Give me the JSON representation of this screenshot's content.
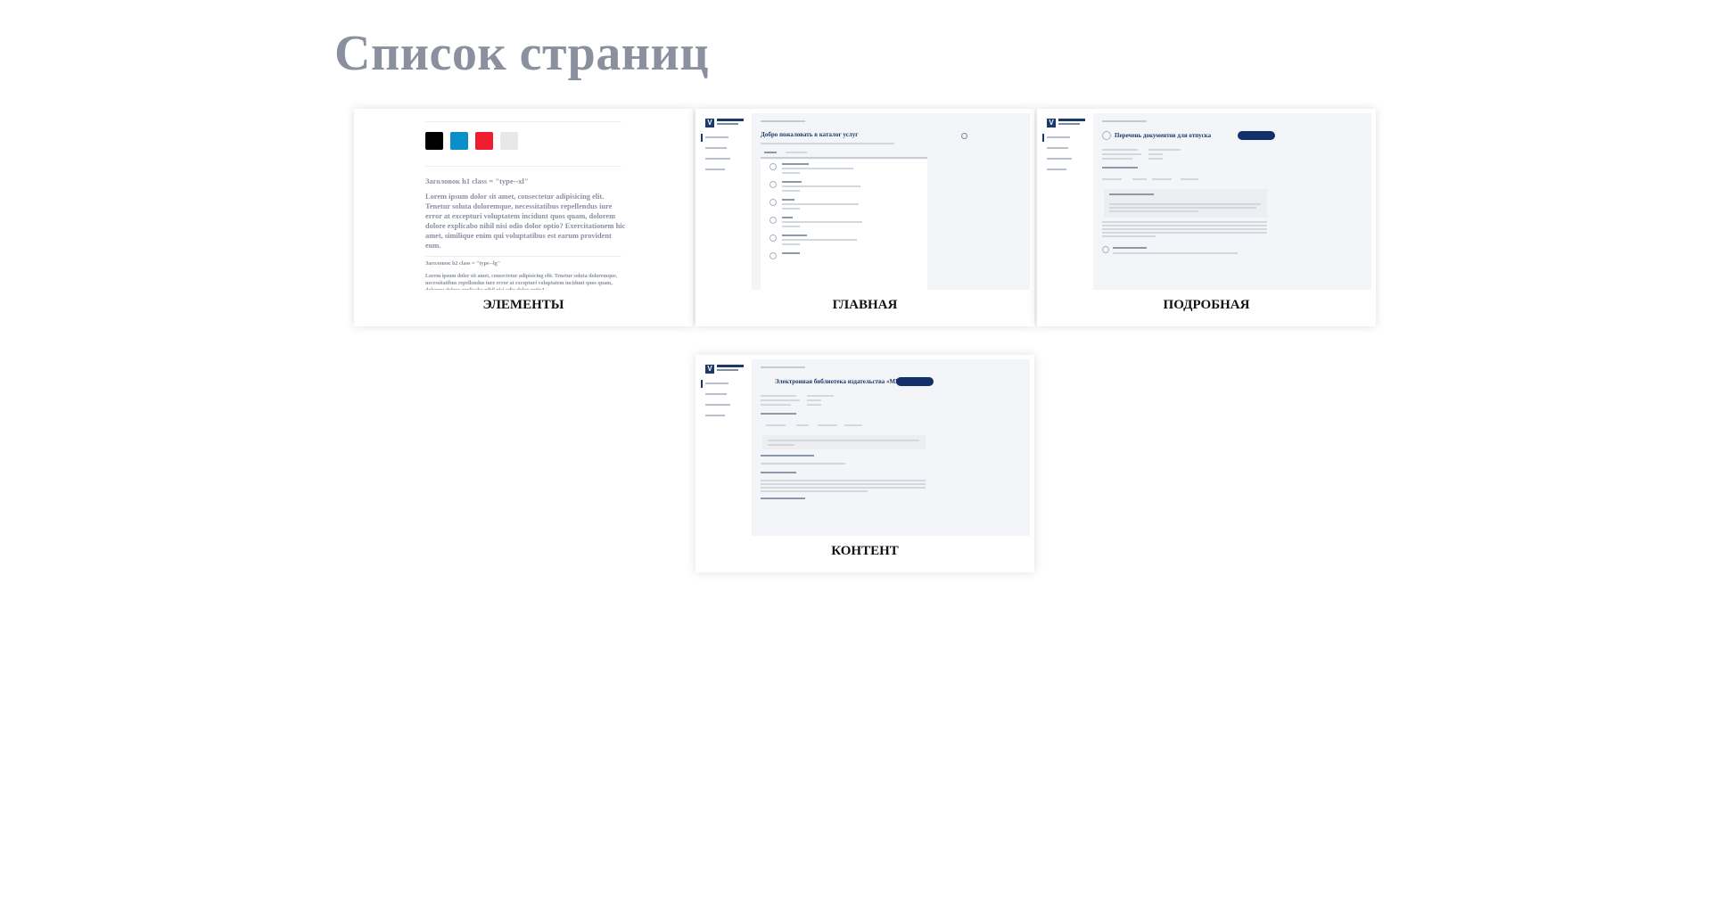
{
  "page": {
    "title": "Список страниц"
  },
  "cards": [
    {
      "label": "ЭЛЕМЕНТЫ"
    },
    {
      "label": "ГЛАВНАЯ"
    },
    {
      "label": "ПОДРОБНАЯ"
    },
    {
      "label": "КОНТЕНТ"
    }
  ],
  "elements_preview": {
    "swatch_colors": [
      "#000000",
      "#0a8fc9",
      "#ee1c2e",
      "#e7e8ea"
    ],
    "h1_caption": "Заголовок h1 class = \"type--xl\"",
    "paragraph": "Lorem ipsum dolor sit amet, consectetur adipisicing elit. Tenetur soluta doloremque, necessitatibus repellendus iure error at excepturi voluptatem incidunt quos quam, dolorem dolore explicabo nihil nisi odio dolor optio? Exercitationem hic amet, similique enim qui voluptatibus est earum provident eum.",
    "h2_caption": "Заголовок h2 class = \"type--lg\"",
    "paragraph_small": "Lorem ipsum dolor sit amet, consectetur adipisicing elit. Tenetur soluta doloremque, necessitatibus repellendus iure error at excepturi voluptatem incidunt quos quam, dolorem dolore explicabo nihil nisi odio dolor optio?"
  },
  "main_preview": {
    "title": "Добро пожаловать в каталог услуг"
  },
  "detail_preview": {
    "title": "Перечень документов для отпуска"
  },
  "content_preview": {
    "title": "Электронная библиотека издательства «МИФ»"
  },
  "colors": {
    "accent": "#14306b",
    "title_gray": "#8a909e"
  }
}
